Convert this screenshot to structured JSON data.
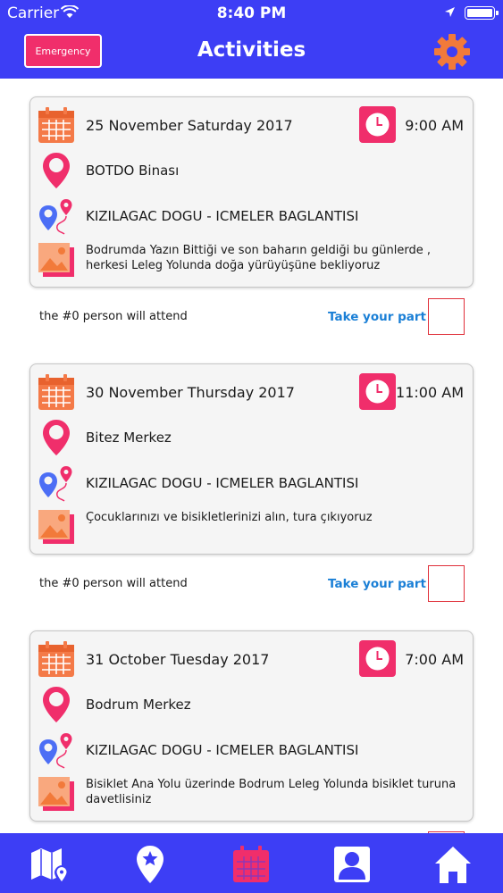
{
  "status": {
    "carrier": "Carrier",
    "time": "8:40 PM"
  },
  "header": {
    "emergency_label": "Emergency",
    "title": "Activities",
    "settings_icon": "gear-icon"
  },
  "colors": {
    "primary": "#3d3ef5",
    "accent": "#f02e6b",
    "link": "#1a7fd6",
    "calendar": "#f47a48",
    "gear": "#f27a3a"
  },
  "activities": [
    {
      "date": "25 November Saturday 2017",
      "time": "9:00 AM",
      "place": "BOTDO Binası",
      "route": "KIZILAGAC DOGU - ICMELER BAGLANTISI",
      "description": "Bodrumda Yazın Bittiği ve son baharın geldiği bu günlerde , herkesi Leleg Yolunda doğa yürüyüşüne bekliyoruz",
      "attend_text": "the #0 person will attend",
      "take_part_label": "Take your part"
    },
    {
      "date": "30 November Thursday 2017",
      "time": "11:00 AM",
      "place": "Bitez Merkez",
      "route": "KIZILAGAC DOGU - ICMELER BAGLANTISI",
      "description": "Çocuklarınızı ve bisikletlerinizi alın, tura çıkıyoruz",
      "attend_text": "the #0 person will attend",
      "take_part_label": "Take your part"
    },
    {
      "date": "31 October Tuesday 2017",
      "time": "7:00 AM",
      "place": "Bodrum Merkez",
      "route": "KIZILAGAC DOGU - ICMELER BAGLANTISI",
      "description": "Bisiklet Ana Yolu üzerinde Bodrum Leleg Yolunda bisiklet turuna davetlisiniz",
      "attend_text": "",
      "take_part_label": ""
    }
  ],
  "tabbar": {
    "items": [
      {
        "icon": "map-icon"
      },
      {
        "icon": "star-pin-icon"
      },
      {
        "icon": "calendar-icon",
        "active": true
      },
      {
        "icon": "contact-icon"
      },
      {
        "icon": "home-icon"
      }
    ]
  }
}
